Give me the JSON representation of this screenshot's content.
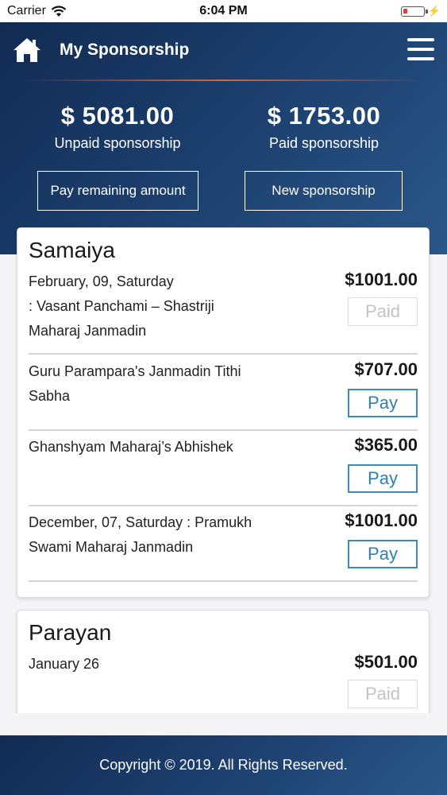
{
  "status_bar": {
    "carrier": "Carrier",
    "time": "6:04 PM",
    "battery_color": "#e23a3a"
  },
  "header": {
    "title": "My Sponsorship",
    "home_icon": "home-icon",
    "menu_icon": "hamburger-menu-icon"
  },
  "summary": {
    "unpaid_amount": "$ 5081.00",
    "unpaid_label": "Unpaid sponsorship",
    "paid_amount": "$ 1753.00",
    "paid_label": "Paid sponsorship"
  },
  "actions": {
    "pay_remaining": "Pay remaining amount",
    "new_sponsorship": "New sponsorship"
  },
  "sections": [
    {
      "title": "Samaiya",
      "items": [
        {
          "description": "February, 09, Saturday\n: Vasant Panchami – Shastriji\nMaharaj Janmadin",
          "amount": "$1001.00",
          "button": "Paid",
          "status": "paid"
        },
        {
          "description": "Guru Parampara's Janmadin Tithi\nSabha",
          "amount": "$707.00",
          "button": "Pay",
          "status": "unpaid"
        },
        {
          "description": "Ghanshyam Maharaj’s Abhishek",
          "amount": "$365.00",
          "button": "Pay",
          "status": "unpaid"
        },
        {
          "description": "December, 07, Saturday : Pramukh\nSwami Maharaj Janmadin",
          "amount": "$1001.00",
          "button": "Pay",
          "status": "unpaid"
        }
      ]
    },
    {
      "title": "Parayan",
      "items": [
        {
          "description": "January 26",
          "amount": "$501.00",
          "button": "Paid",
          "status": "paid"
        }
      ]
    }
  ],
  "footer": {
    "copyright": "Copyright © 2019. All Rights Reserved."
  },
  "colors": {
    "header_dark": "#112b52",
    "header_light": "#2a5789",
    "pay_button": "#2f7fb3",
    "paid_button": "#c4c4c4",
    "divider_accent": "#e66e3c"
  }
}
